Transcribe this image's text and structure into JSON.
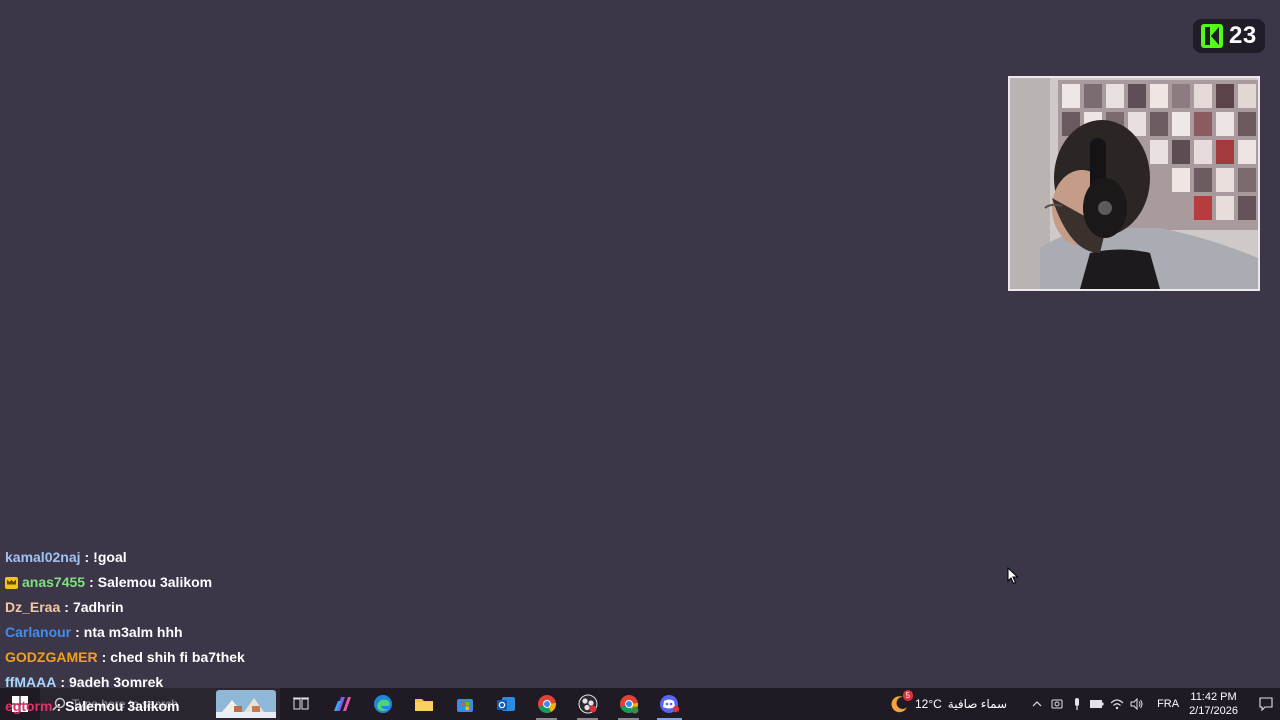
{
  "viewer_badge": {
    "platform_icon": "kick-logo-icon",
    "count": "23",
    "accent": "#53fc18"
  },
  "webcam": {
    "description_icon": "webcam-feed"
  },
  "chat": {
    "messages": [
      {
        "user": "kamal02naj",
        "separator": ":",
        "text": "!goal",
        "color": "#9ec3f0",
        "badge": ""
      },
      {
        "user": "anas7455",
        "separator": ":",
        "text": "Salemou 3alikom",
        "color": "#7fe07f",
        "badge": "crown-icon"
      },
      {
        "user": "Dz_Eraa",
        "separator": ":",
        "text": "7adhrin",
        "color": "#f3c9a0",
        "badge": ""
      },
      {
        "user": "Carlanour",
        "separator": ":",
        "text": "nta m3alm hhh",
        "color": "#3f8ff0",
        "badge": ""
      },
      {
        "user": "GODZGAMER",
        "separator": ":",
        "text": "ched shih fi ba7thek",
        "color": "#f0a020",
        "badge": ""
      },
      {
        "user": "ffMAAA",
        "separator": ":",
        "text": "9adeh 3omrek",
        "color": "#a8d8ff",
        "badge": ""
      }
    ],
    "overlap": {
      "user": "egtorm",
      "separator": ":",
      "text": "Salemou 3alikom",
      "color": "#e0306a"
    }
  },
  "taskbar": {
    "search_placeholder": "Type here to search",
    "apps": [
      {
        "name": "task-view-icon",
        "state": ""
      },
      {
        "name": "copilot-icon",
        "state": ""
      },
      {
        "name": "edge-icon",
        "state": ""
      },
      {
        "name": "file-explorer-icon",
        "state": ""
      },
      {
        "name": "microsoft-store-icon",
        "state": ""
      },
      {
        "name": "outlook-icon",
        "state": ""
      },
      {
        "name": "chrome-icon",
        "state": "open"
      },
      {
        "name": "obs-icon",
        "state": "open"
      },
      {
        "name": "chrome-profile-icon",
        "state": "open"
      },
      {
        "name": "discord-icon",
        "state": "active"
      }
    ],
    "weather": {
      "temp": "12°C",
      "condition": "سماء صافية",
      "alert_count": "5"
    },
    "language": "FRA",
    "time": "11:42 PM",
    "date": "2/17/2026"
  }
}
